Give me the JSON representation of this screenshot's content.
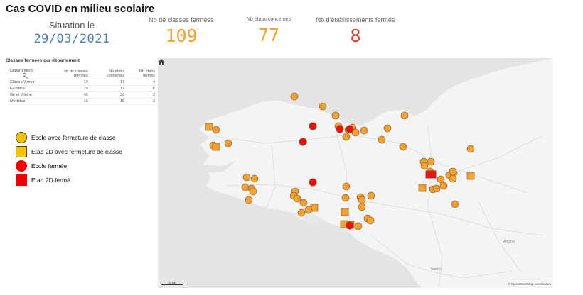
{
  "header": {
    "title": "Cas COVID en milieu scolaire"
  },
  "kpis": {
    "date": {
      "label": "Situation le",
      "value": "29/03/2021"
    },
    "classes": {
      "label": "Nb de classes fermées",
      "value": "109"
    },
    "etabs": {
      "label": "Nb étabs concernés",
      "value": "77"
    },
    "fermes": {
      "label": "Nb d'établissements fermés",
      "value": "8"
    }
  },
  "table": {
    "title": "Classes fermées par département",
    "headers": [
      "Département",
      "nb de classes fermées",
      "Nb étabs concernés",
      "Nb étabs fermés"
    ],
    "rows": [
      [
        "Côtes d'Armor",
        "19",
        "17",
        "4"
      ],
      [
        "Finistère",
        "29",
        "17",
        "6"
      ],
      [
        "Ille et Vilaine",
        "46",
        "28",
        "2"
      ],
      [
        "Morbihan",
        "15",
        "15",
        "2"
      ]
    ]
  },
  "legend": {
    "items": [
      {
        "label": "Ecole avec fermeture de classe",
        "symbol": "circle",
        "color": "#f5c200"
      },
      {
        "label": "Etab 2D avec fermeture de classe",
        "symbol": "square",
        "color": "#f5c200"
      },
      {
        "label": "Ecole fermée",
        "symbol": "circle",
        "color": "#ee0000"
      },
      {
        "label": "Etab 2D fermé",
        "symbol": "square",
        "color": "#ee0000"
      }
    ]
  },
  "map": {
    "cities": [
      "Angers",
      "Nantes"
    ],
    "scale_label": "20 km",
    "attribution": "© OpenStreetMap contributors",
    "marker_colors": {
      "orange": "#f0a232",
      "red": "#ee1111"
    }
  }
}
